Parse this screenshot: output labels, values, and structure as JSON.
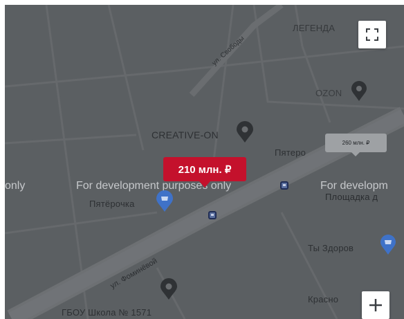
{
  "map": {
    "streets": {
      "svobody": "ул. Свободы",
      "fominykh": "ул. Фоминёвой"
    },
    "places": {
      "legenda": "ЛЕГЕНДА",
      "ozon": "OZON",
      "creative_on": "CREATIVE-ON",
      "pyaterochka_top": "Пятеро",
      "pyaterochka": "Пятёрочка",
      "ploshchadka": "Площадка д",
      "ty_zdorov": "Ты Здоров",
      "krasnoe": "Красно",
      "school": "ГБОУ Школа № 1571"
    },
    "watermarks": {
      "left": "only",
      "center": "For development purposes only",
      "right": "For developm"
    }
  },
  "price_markers": {
    "main": "210 млн. ₽",
    "secondary": "260 млн. ₽"
  },
  "controls": {
    "fullscreen_icon": "fullscreen-icon",
    "zoom_in_icon": "plus-icon"
  },
  "colors": {
    "map_bg": "#5b5f62",
    "price_accent": "#c4112c",
    "poi_pin": "#2f3235",
    "shop_pin": "#3f72c8"
  }
}
